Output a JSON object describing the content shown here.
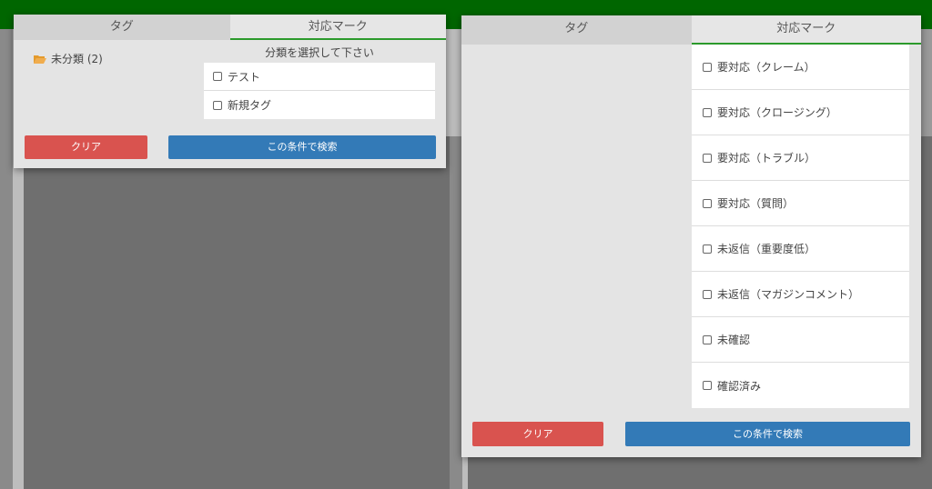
{
  "small_panel": {
    "tabs": [
      "タグ",
      "対応マーク"
    ],
    "folder": {
      "label": "未分類 (2)",
      "icon": "folder-open-icon"
    },
    "prompt": "分類を選択して下さい",
    "tags": [
      "テスト",
      "新規タグ"
    ],
    "clear_label": "クリア",
    "search_label": "この条件で検索"
  },
  "large_panel": {
    "tabs": [
      "タグ",
      "対応マーク"
    ],
    "marks": [
      "要対応（クレーム）",
      "要対応（クロージング）",
      "要対応（トラブル）",
      "要対応（質問）",
      "未返信（重要度低）",
      "未返信（マガジンコメント）",
      "未確認",
      "確認済み"
    ],
    "clear_label": "クリア",
    "search_label": "この条件で検索"
  },
  "colors": {
    "topbar": "#006600",
    "active_tab_underline": "#2b9a2b",
    "clear_button": "#d9534f",
    "search_button": "#337ab7",
    "folder_icon": "#f0ad4e"
  }
}
